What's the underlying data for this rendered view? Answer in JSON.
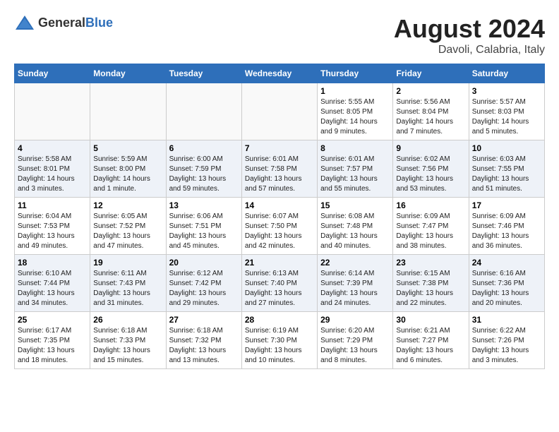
{
  "header": {
    "logo_general": "General",
    "logo_blue": "Blue",
    "month_year": "August 2024",
    "location": "Davoli, Calabria, Italy"
  },
  "weekdays": [
    "Sunday",
    "Monday",
    "Tuesday",
    "Wednesday",
    "Thursday",
    "Friday",
    "Saturday"
  ],
  "weeks": [
    [
      {
        "day": "",
        "info": ""
      },
      {
        "day": "",
        "info": ""
      },
      {
        "day": "",
        "info": ""
      },
      {
        "day": "",
        "info": ""
      },
      {
        "day": "1",
        "info": "Sunrise: 5:55 AM\nSunset: 8:05 PM\nDaylight: 14 hours\nand 9 minutes."
      },
      {
        "day": "2",
        "info": "Sunrise: 5:56 AM\nSunset: 8:04 PM\nDaylight: 14 hours\nand 7 minutes."
      },
      {
        "day": "3",
        "info": "Sunrise: 5:57 AM\nSunset: 8:03 PM\nDaylight: 14 hours\nand 5 minutes."
      }
    ],
    [
      {
        "day": "4",
        "info": "Sunrise: 5:58 AM\nSunset: 8:01 PM\nDaylight: 14 hours\nand 3 minutes."
      },
      {
        "day": "5",
        "info": "Sunrise: 5:59 AM\nSunset: 8:00 PM\nDaylight: 14 hours\nand 1 minute."
      },
      {
        "day": "6",
        "info": "Sunrise: 6:00 AM\nSunset: 7:59 PM\nDaylight: 13 hours\nand 59 minutes."
      },
      {
        "day": "7",
        "info": "Sunrise: 6:01 AM\nSunset: 7:58 PM\nDaylight: 13 hours\nand 57 minutes."
      },
      {
        "day": "8",
        "info": "Sunrise: 6:01 AM\nSunset: 7:57 PM\nDaylight: 13 hours\nand 55 minutes."
      },
      {
        "day": "9",
        "info": "Sunrise: 6:02 AM\nSunset: 7:56 PM\nDaylight: 13 hours\nand 53 minutes."
      },
      {
        "day": "10",
        "info": "Sunrise: 6:03 AM\nSunset: 7:55 PM\nDaylight: 13 hours\nand 51 minutes."
      }
    ],
    [
      {
        "day": "11",
        "info": "Sunrise: 6:04 AM\nSunset: 7:53 PM\nDaylight: 13 hours\nand 49 minutes."
      },
      {
        "day": "12",
        "info": "Sunrise: 6:05 AM\nSunset: 7:52 PM\nDaylight: 13 hours\nand 47 minutes."
      },
      {
        "day": "13",
        "info": "Sunrise: 6:06 AM\nSunset: 7:51 PM\nDaylight: 13 hours\nand 45 minutes."
      },
      {
        "day": "14",
        "info": "Sunrise: 6:07 AM\nSunset: 7:50 PM\nDaylight: 13 hours\nand 42 minutes."
      },
      {
        "day": "15",
        "info": "Sunrise: 6:08 AM\nSunset: 7:48 PM\nDaylight: 13 hours\nand 40 minutes."
      },
      {
        "day": "16",
        "info": "Sunrise: 6:09 AM\nSunset: 7:47 PM\nDaylight: 13 hours\nand 38 minutes."
      },
      {
        "day": "17",
        "info": "Sunrise: 6:09 AM\nSunset: 7:46 PM\nDaylight: 13 hours\nand 36 minutes."
      }
    ],
    [
      {
        "day": "18",
        "info": "Sunrise: 6:10 AM\nSunset: 7:44 PM\nDaylight: 13 hours\nand 34 minutes."
      },
      {
        "day": "19",
        "info": "Sunrise: 6:11 AM\nSunset: 7:43 PM\nDaylight: 13 hours\nand 31 minutes."
      },
      {
        "day": "20",
        "info": "Sunrise: 6:12 AM\nSunset: 7:42 PM\nDaylight: 13 hours\nand 29 minutes."
      },
      {
        "day": "21",
        "info": "Sunrise: 6:13 AM\nSunset: 7:40 PM\nDaylight: 13 hours\nand 27 minutes."
      },
      {
        "day": "22",
        "info": "Sunrise: 6:14 AM\nSunset: 7:39 PM\nDaylight: 13 hours\nand 24 minutes."
      },
      {
        "day": "23",
        "info": "Sunrise: 6:15 AM\nSunset: 7:38 PM\nDaylight: 13 hours\nand 22 minutes."
      },
      {
        "day": "24",
        "info": "Sunrise: 6:16 AM\nSunset: 7:36 PM\nDaylight: 13 hours\nand 20 minutes."
      }
    ],
    [
      {
        "day": "25",
        "info": "Sunrise: 6:17 AM\nSunset: 7:35 PM\nDaylight: 13 hours\nand 18 minutes."
      },
      {
        "day": "26",
        "info": "Sunrise: 6:18 AM\nSunset: 7:33 PM\nDaylight: 13 hours\nand 15 minutes."
      },
      {
        "day": "27",
        "info": "Sunrise: 6:18 AM\nSunset: 7:32 PM\nDaylight: 13 hours\nand 13 minutes."
      },
      {
        "day": "28",
        "info": "Sunrise: 6:19 AM\nSunset: 7:30 PM\nDaylight: 13 hours\nand 10 minutes."
      },
      {
        "day": "29",
        "info": "Sunrise: 6:20 AM\nSunset: 7:29 PM\nDaylight: 13 hours\nand 8 minutes."
      },
      {
        "day": "30",
        "info": "Sunrise: 6:21 AM\nSunset: 7:27 PM\nDaylight: 13 hours\nand 6 minutes."
      },
      {
        "day": "31",
        "info": "Sunrise: 6:22 AM\nSunset: 7:26 PM\nDaylight: 13 hours\nand 3 minutes."
      }
    ]
  ]
}
